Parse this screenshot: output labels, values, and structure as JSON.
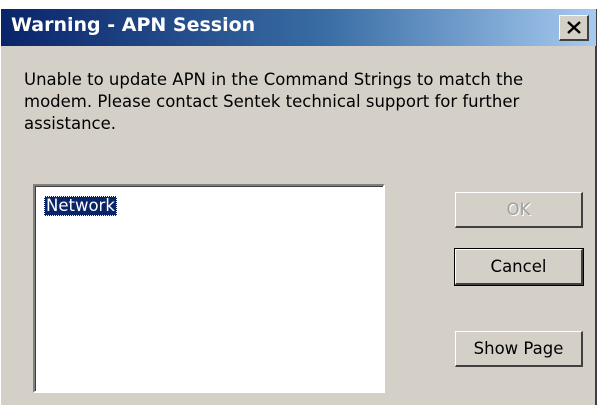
{
  "dialog": {
    "title": "Warning - APN Session",
    "message": "Unable to update APN in the Command Strings to match the modem. Please contact Sentek technical support for further assistance.",
    "list": {
      "items": [
        "Network"
      ],
      "selected": "Network"
    },
    "buttons": {
      "ok_label": "OK",
      "cancel_label": "Cancel",
      "show_page_label": "Show Page"
    },
    "close_icon": "close-icon"
  },
  "colors": {
    "title_start": "#0a246a",
    "title_end": "#a6caf0",
    "face": "#d4d0c8",
    "selection": "#0a246a"
  }
}
